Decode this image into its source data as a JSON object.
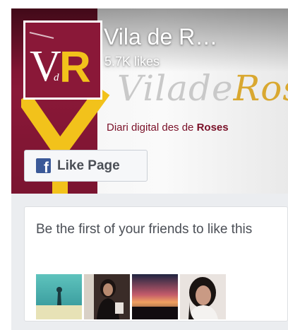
{
  "page": {
    "name": "Vila de R…",
    "likes": "5.7K likes"
  },
  "cover": {
    "wordmark_light": "Vilade",
    "wordmark_gold": "Ros",
    "tagline_prefix": "Diari digital des de ",
    "tagline_bold": "Roses"
  },
  "avatar": {
    "logo_text_v": "V",
    "logo_text_d": "d",
    "logo_text_r": "R"
  },
  "like_button": {
    "label": "Like Page",
    "icon": "facebook-f-icon"
  },
  "friends": {
    "prompt": "Be the first of your friends to like this",
    "faces": [
      {
        "name": "friend-photo-1"
      },
      {
        "name": "friend-photo-2"
      },
      {
        "name": "friend-photo-3"
      },
      {
        "name": "friend-photo-4"
      }
    ]
  },
  "colors": {
    "maroon": "#8a1838",
    "gold": "#f2c21b",
    "facebook_blue": "#3b5998",
    "text_gray": "#4b4f56"
  }
}
